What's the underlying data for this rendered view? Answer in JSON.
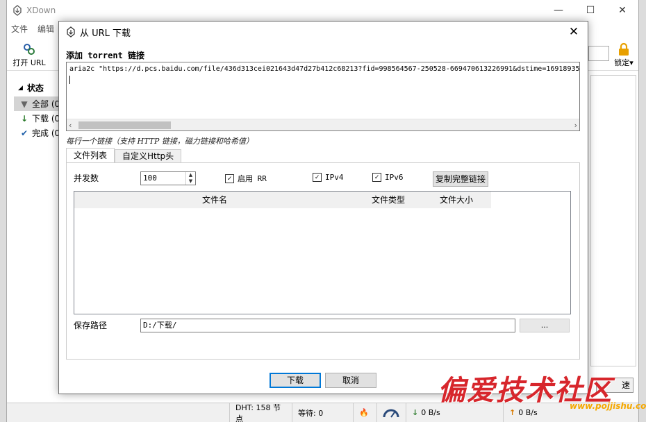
{
  "main": {
    "title": "XDown",
    "menu": [
      "文件",
      "编辑"
    ],
    "toolbar": {
      "open_url": "打开 URL",
      "lock": "锁定"
    },
    "sidebar": {
      "header": "状态",
      "items": [
        {
          "label": "全部 (0",
          "icon": "filter-icon"
        },
        {
          "label": "下载 (0",
          "icon": "arrow-down-icon"
        },
        {
          "label": "完成 (0",
          "icon": "check-icon"
        }
      ]
    },
    "speed_button": "速",
    "status": {
      "dht": "DHT: 158 节点",
      "waiting": "等待: 0",
      "download_speed": "0 B/s",
      "upload_speed": "0 B/s"
    }
  },
  "dialog": {
    "title": "从 URL 下载",
    "section_title": "添加 torrent 链接",
    "url_text": "aria2c \"https://d.pcs.baidu.com/file/436d313cei021643d47d27b412c68213?fid=998564567-250528-669470613226991&dstime=16918935",
    "hint": "每行一个链接（支持 HTTP 链接，磁力链接和哈希值）",
    "tabs": [
      "文件列表",
      "自定义Http头"
    ],
    "concurrency_label": "并发数",
    "concurrency_value": "100",
    "rr_label": "启用 RR",
    "ipv4_label": "IPv4",
    "ipv6_label": "IPv6",
    "copy_link_button": "复制完整链接",
    "columns": [
      "文件名",
      "文件类型",
      "文件大小"
    ],
    "save_path_label": "保存路径",
    "save_path_value": "D:/下载/",
    "browse_button": "...",
    "download_button": "下载",
    "cancel_button": "取消"
  },
  "watermark": {
    "text": "偏爱技术社区",
    "url": "www.pojjishu.com"
  },
  "colors": {
    "accent": "#0078d7",
    "watermark": "#d7262c",
    "lock": "#e8a000"
  }
}
